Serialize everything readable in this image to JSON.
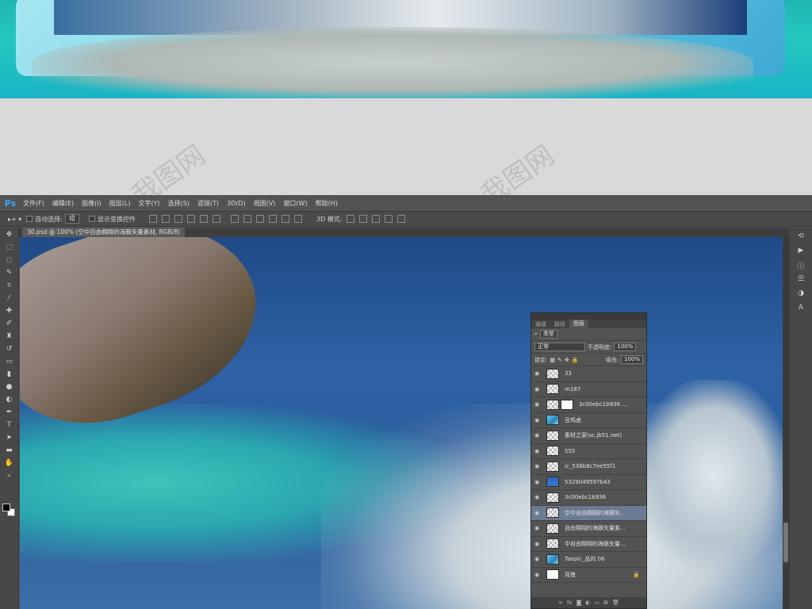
{
  "watermark": {
    "text": "我图网"
  },
  "ps": {
    "logo": "Ps",
    "menu": [
      "文件(F)",
      "编辑(E)",
      "图像(I)",
      "图层(L)",
      "文字(Y)",
      "选择(S)",
      "滤镜(T)",
      "3D(D)",
      "视图(V)",
      "窗口(W)",
      "帮助(H)"
    ],
    "options": {
      "auto_select_label": "自动选择:",
      "auto_select_value": "组",
      "show_transform_label": "显示变换控件",
      "mode_3d_label": "3D 模式:"
    },
    "document_tab": "30.psd @ 100% (空中自由翱翔的海豚矢量素材, RGB/8)",
    "layers_panel": {
      "tabs": [
        "通道",
        "路径",
        "图层"
      ],
      "active_tab": "图层",
      "kind_value": "类型",
      "blend_mode": "正常",
      "opacity_label": "不透明度:",
      "opacity_value": "100%",
      "lock_label": "锁定:",
      "fill_label": "填充:",
      "fill_value": "100%",
      "layers": [
        {
          "name": "33",
          "thumb": "checker"
        },
        {
          "name": "m187",
          "thumb": "checker"
        },
        {
          "name": "3c00ebc1b936 ...",
          "thumb": "checker",
          "mask": true
        },
        {
          "name": "豆鸡卤",
          "thumb": "teal"
        },
        {
          "name": "素材之家(sc.jb51.net)",
          "thumb": "checker"
        },
        {
          "name": "555",
          "thumb": "checker"
        },
        {
          "name": "ic_536b8c7ee55f1",
          "thumb": "checker"
        },
        {
          "name": "5329049597b43",
          "thumb": "blue"
        },
        {
          "name": "3c00ebc1b936",
          "thumb": "checker"
        },
        {
          "name": "空中自由翱翔的海豚矢...",
          "thumb": "checker",
          "selected": true
        },
        {
          "name": "自由翱翔的海豚矢量素...",
          "thumb": "checker"
        },
        {
          "name": "中自由翱翔的海豚矢量...",
          "thumb": "checker"
        },
        {
          "name": "Taopic_品的 06",
          "thumb": "teal"
        },
        {
          "name": "背景",
          "thumb": "white",
          "locked": true
        }
      ],
      "bottom_icons": [
        "link-icon",
        "fx-icon",
        "mask-icon",
        "adjustment-icon",
        "folder-icon",
        "new-layer-icon",
        "trash-icon"
      ]
    }
  }
}
